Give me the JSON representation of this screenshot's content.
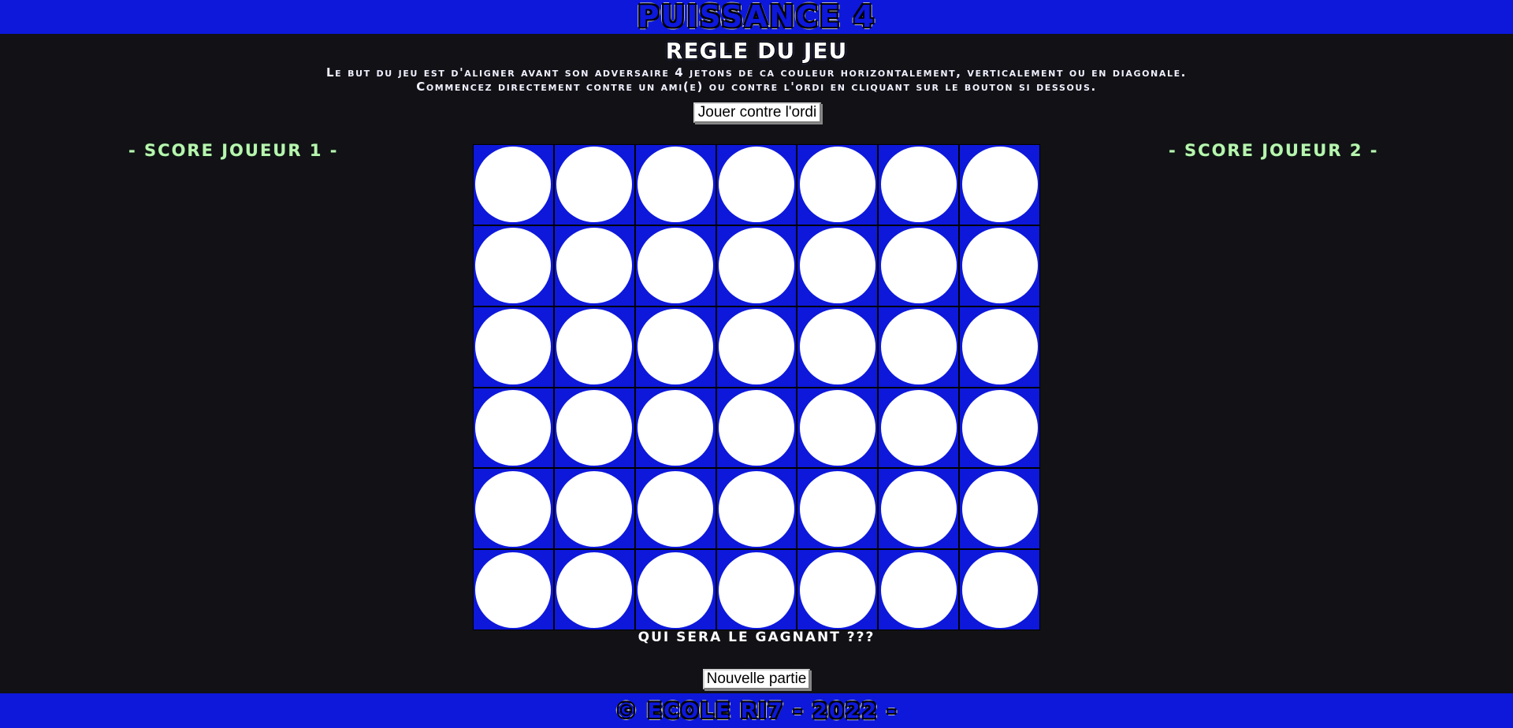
{
  "header": {
    "title": "PUISSANCE 4"
  },
  "rules": {
    "title": "REGLE DU JEU",
    "line1": "Le but du jeu est d'aligner avant son adversaire 4 jetons de ca couleur horizontalement, verticalement ou en diagonale.",
    "line2": "Commencez directement contre un ami(e) ou contre l'ordi en cliquant sur le bouton si dessous."
  },
  "controls": {
    "play_computer_label": "Jouer contre l'ordi",
    "new_game_label": "Nouvelle partie"
  },
  "scores": {
    "player1_label": "- SCORE JOUEUR 1 -",
    "player2_label": "- SCORE JOUEUR 2 -"
  },
  "board": {
    "rows": 6,
    "columns": 7,
    "cells": [
      [
        "empty",
        "empty",
        "empty",
        "empty",
        "empty",
        "empty",
        "empty"
      ],
      [
        "empty",
        "empty",
        "empty",
        "empty",
        "empty",
        "empty",
        "empty"
      ],
      [
        "empty",
        "empty",
        "empty",
        "empty",
        "empty",
        "empty",
        "empty"
      ],
      [
        "empty",
        "empty",
        "empty",
        "empty",
        "empty",
        "empty",
        "empty"
      ],
      [
        "empty",
        "empty",
        "empty",
        "empty",
        "empty",
        "empty",
        "empty"
      ],
      [
        "empty",
        "empty",
        "empty",
        "empty",
        "empty",
        "empty",
        "empty"
      ]
    ],
    "board_color": "#0d18db",
    "empty_color": "#ffffff"
  },
  "status": {
    "message": "QUI SERA LE GAGNANT ???"
  },
  "footer": {
    "text": "© ECOLE RI7 - 2022 -"
  },
  "colors": {
    "brand_blue": "#0d18db",
    "background": "#111116",
    "score_green": "#b8f5b0"
  }
}
